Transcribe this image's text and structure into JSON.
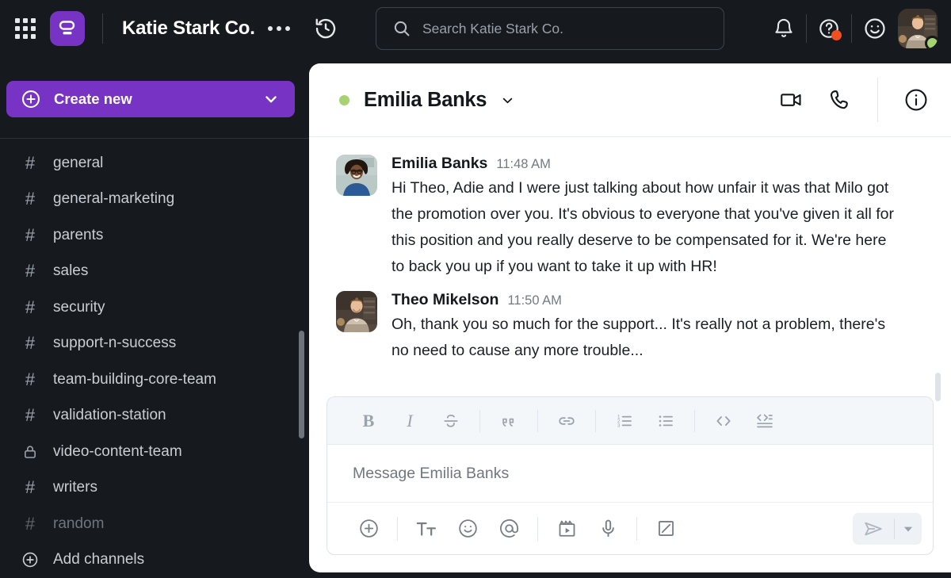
{
  "topbar": {
    "apps_icon": "grid-apps-icon",
    "logo_icon": "brand-logo-icon",
    "workspace_title": "Katie Stark Co.",
    "more_icon": "kebab-more-icon",
    "history_icon": "history-clock-icon",
    "notifications_icon": "bell-icon",
    "help_icon": "help-question-icon",
    "emoji_icon": "smiley-icon",
    "avatar_name": "user-avatar",
    "presence": "online",
    "presence_color": "#a7d274",
    "help_badge_color": "#f24e1e"
  },
  "search": {
    "placeholder": "Search Katie Stark Co.",
    "icon": "search-icon",
    "value": ""
  },
  "sidebar": {
    "create_new_label": "Create new",
    "create_new_icon": "plus-circle-icon",
    "create_new_caret": "chevron-down-icon",
    "accent_color": "#7734c4",
    "channels": [
      {
        "label": "general",
        "icon": "hash-icon",
        "muted": false
      },
      {
        "label": "general-marketing",
        "icon": "hash-icon",
        "muted": false
      },
      {
        "label": "parents",
        "icon": "hash-icon",
        "muted": false
      },
      {
        "label": "sales",
        "icon": "hash-icon",
        "muted": false
      },
      {
        "label": "security",
        "icon": "hash-icon",
        "muted": false
      },
      {
        "label": "support-n-success",
        "icon": "hash-icon",
        "muted": false
      },
      {
        "label": "team-building-core-team",
        "icon": "hash-icon",
        "muted": false
      },
      {
        "label": "validation-station",
        "icon": "hash-icon",
        "muted": false
      },
      {
        "label": "video-content-team",
        "icon": "lock-icon",
        "muted": false
      },
      {
        "label": "writers",
        "icon": "hash-icon",
        "muted": false
      },
      {
        "label": "random",
        "icon": "hash-icon",
        "muted": true
      }
    ],
    "add_channels_label": "Add channels",
    "add_channels_icon": "plus-circle-icon"
  },
  "chat": {
    "header": {
      "name": "Emilia Banks",
      "presence_color": "#a7d274",
      "caret_icon": "chevron-down-icon",
      "video_icon": "video-camera-icon",
      "call_icon": "phone-icon",
      "info_icon": "info-circle-icon"
    },
    "messages": [
      {
        "author": "Emilia Banks",
        "time": "11:48 AM",
        "text": "Hi Theo, Adie and I were just talking about how unfair it was that Milo got the promotion over you. It's obvious to everyone that you've given it all for this position and you really deserve to be compensated for it. We're here to back you up if you want to take it up with HR!",
        "avatar": "emilia-banks-avatar"
      },
      {
        "author": "Theo Mikelson",
        "time": "11:50 AM",
        "text": "Oh, thank you so much for the support... It's really not a problem, there's no need to cause any more trouble...",
        "avatar": "theo-mikelson-avatar"
      }
    ]
  },
  "composer": {
    "placeholder": "Message Emilia Banks",
    "value": "",
    "format_buttons": [
      {
        "name": "bold-icon",
        "label": "B"
      },
      {
        "name": "italic-icon",
        "label": "I"
      },
      {
        "name": "strikethrough-icon",
        "label": "S"
      },
      {
        "name": "blockquote-icon",
        "label": "””"
      },
      {
        "name": "link-icon",
        "label": ""
      },
      {
        "name": "ordered-list-icon",
        "label": ""
      },
      {
        "name": "bulleted-list-icon",
        "label": ""
      },
      {
        "name": "inline-code-icon",
        "label": ""
      },
      {
        "name": "code-block-icon",
        "label": ""
      }
    ],
    "action_buttons": [
      {
        "name": "add-attachment-icon"
      },
      {
        "name": "text-format-icon"
      },
      {
        "name": "emoji-icon"
      },
      {
        "name": "mention-icon"
      },
      {
        "name": "video-clip-icon"
      },
      {
        "name": "microphone-icon"
      },
      {
        "name": "draw-icon"
      }
    ],
    "send_icon": "send-icon",
    "send_options_icon": "chevron-down-icon"
  }
}
